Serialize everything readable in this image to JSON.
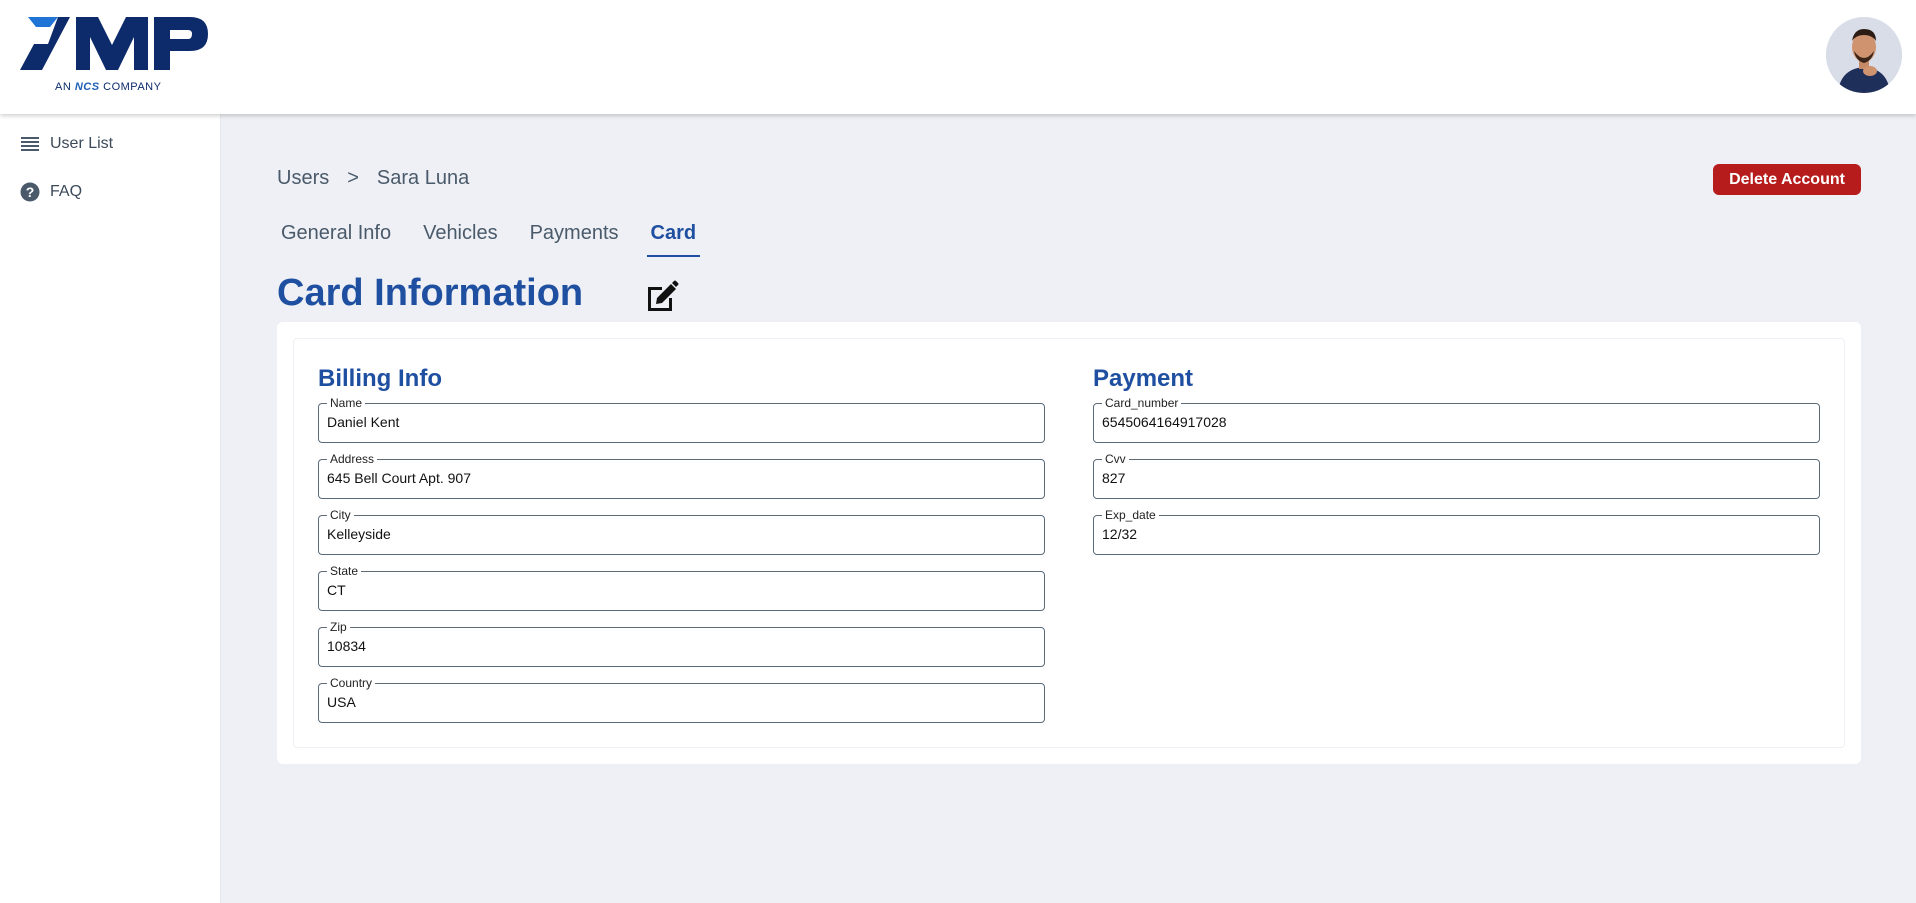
{
  "brand": {
    "logo_text": "AMP",
    "logo_tagline_prefix": "AN",
    "logo_tagline_brand": "NCS",
    "logo_tagline_suffix": "COMPANY",
    "accent": "#1f4fa0",
    "danger": "#b71c1c"
  },
  "sidebar": {
    "items": [
      {
        "label": "User List",
        "icon": "list-icon"
      },
      {
        "label": "FAQ",
        "icon": "question-circle-icon"
      }
    ]
  },
  "breadcrumb": {
    "parent": "Users",
    "separator": ">",
    "current": "Sara Luna"
  },
  "actions": {
    "delete_label": "Delete Account"
  },
  "tabs": [
    {
      "label": "General Info",
      "active": false
    },
    {
      "label": "Vehicles",
      "active": false
    },
    {
      "label": "Payments",
      "active": false
    },
    {
      "label": "Card",
      "active": true
    }
  ],
  "page_title": "Card Information",
  "billing": {
    "title": "Billing Info",
    "fields": [
      {
        "label": "Name",
        "value": "Daniel Kent"
      },
      {
        "label": "Address",
        "value": "645 Bell Court Apt. 907"
      },
      {
        "label": "City",
        "value": "Kelleyside"
      },
      {
        "label": "State",
        "value": "CT"
      },
      {
        "label": "Zip",
        "value": "10834"
      },
      {
        "label": "Country",
        "value": "USA"
      }
    ]
  },
  "payment": {
    "title": "Payment",
    "fields": [
      {
        "label": "Card_number",
        "value": "6545064164917028"
      },
      {
        "label": "Cvv",
        "value": "827"
      },
      {
        "label": "Exp_date",
        "value": "12/32"
      }
    ]
  }
}
